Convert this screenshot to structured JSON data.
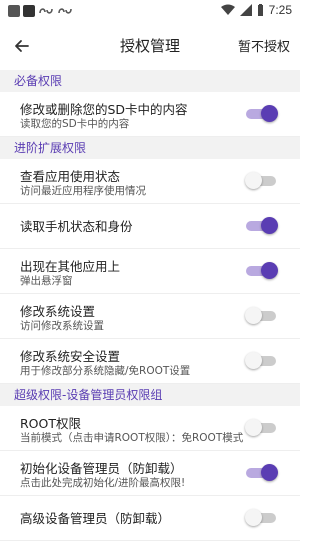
{
  "status_bar": {
    "time": "7:25"
  },
  "toolbar": {
    "title": "授权管理",
    "action_label": "暂不授权"
  },
  "sections": [
    {
      "header": "必备权限",
      "items": [
        {
          "title": "修改或删除您的SD卡中的内容",
          "subtitle": "读取您的SD卡中的内容",
          "enabled": true
        }
      ]
    },
    {
      "header": "进阶扩展权限",
      "items": [
        {
          "title": "查看应用使用状态",
          "subtitle": "访问最近应用程序使用情况",
          "enabled": false
        },
        {
          "title": "读取手机状态和身份",
          "subtitle": "",
          "enabled": true
        },
        {
          "title": "出现在其他应用上",
          "subtitle": "弹出悬浮窗",
          "enabled": true
        },
        {
          "title": "修改系统设置",
          "subtitle": "访问修改系统设置",
          "enabled": false
        },
        {
          "title": "修改系统安全设置",
          "subtitle": "用于修改部分系统隐藏/免ROOT设置",
          "enabled": false
        }
      ]
    },
    {
      "header": "超级权限-设备管理员权限组",
      "items": [
        {
          "title": "ROOT权限",
          "subtitle": "当前模式（点击申请ROOT权限）：免ROOT模式",
          "enabled": false
        },
        {
          "title": "初始化设备管理员（防卸载）",
          "subtitle": "点击此处完成初始化/进阶最高权限!",
          "enabled": true
        },
        {
          "title": "高级设备管理员（防卸载）",
          "subtitle": "",
          "enabled": false
        }
      ]
    }
  ],
  "colors": {
    "accent": "#5a3db3",
    "toggle_on_track": "#b9a9e0",
    "toggle_off_track": "#cccccc",
    "section_bg": "#f2f2f2"
  }
}
